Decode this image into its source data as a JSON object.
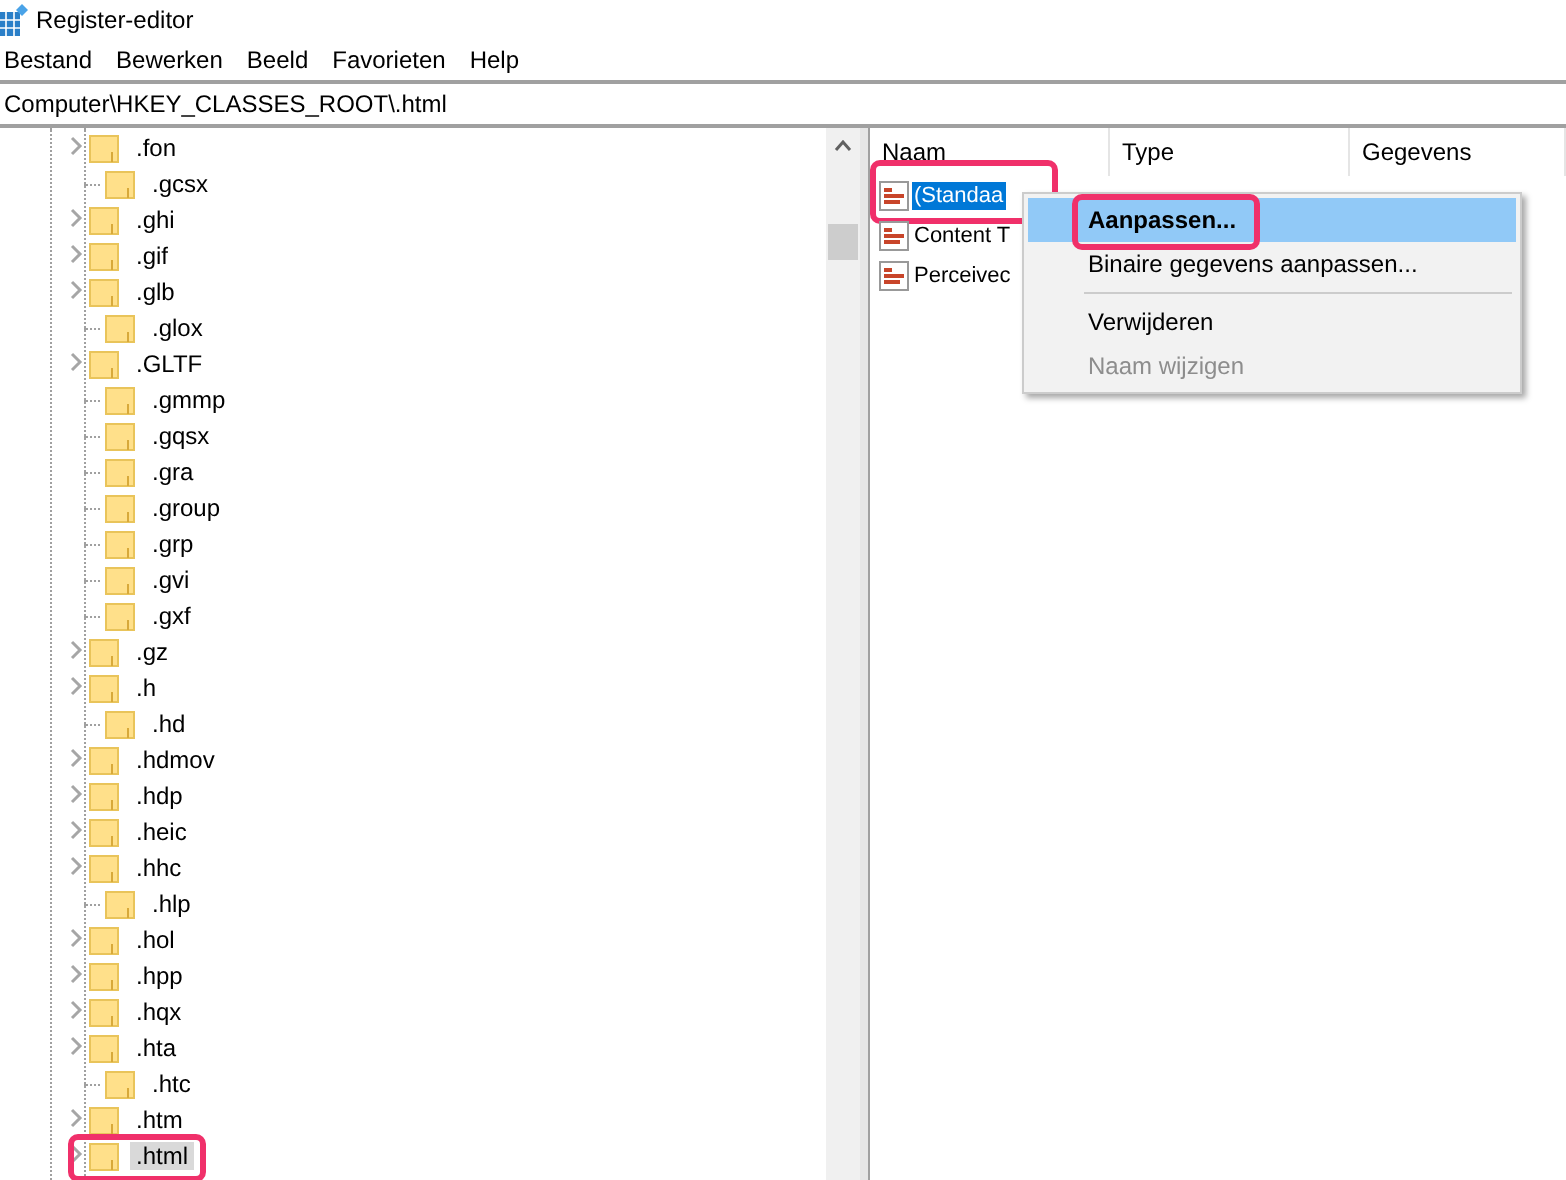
{
  "window": {
    "title": "Register-editor"
  },
  "menu_bar": [
    "Bestand",
    "Bewerken",
    "Beeld",
    "Favorieten",
    "Help"
  ],
  "address": "Computer\\HKEY_CLASSES_ROOT\\.html",
  "tree": [
    {
      "label": ".fon",
      "expandable": true,
      "selected": false,
      "annotated": false
    },
    {
      "label": ".gcsx",
      "expandable": false,
      "selected": false,
      "annotated": false
    },
    {
      "label": ".ghi",
      "expandable": true,
      "selected": false,
      "annotated": false
    },
    {
      "label": ".gif",
      "expandable": true,
      "selected": false,
      "annotated": false
    },
    {
      "label": ".glb",
      "expandable": true,
      "selected": false,
      "annotated": false
    },
    {
      "label": ".glox",
      "expandable": false,
      "selected": false,
      "annotated": false
    },
    {
      "label": ".GLTF",
      "expandable": true,
      "selected": false,
      "annotated": false
    },
    {
      "label": ".gmmp",
      "expandable": false,
      "selected": false,
      "annotated": false
    },
    {
      "label": ".gqsx",
      "expandable": false,
      "selected": false,
      "annotated": false
    },
    {
      "label": ".gra",
      "expandable": false,
      "selected": false,
      "annotated": false
    },
    {
      "label": ".group",
      "expandable": false,
      "selected": false,
      "annotated": false
    },
    {
      "label": ".grp",
      "expandable": false,
      "selected": false,
      "annotated": false
    },
    {
      "label": ".gvi",
      "expandable": false,
      "selected": false,
      "annotated": false
    },
    {
      "label": ".gxf",
      "expandable": false,
      "selected": false,
      "annotated": false
    },
    {
      "label": ".gz",
      "expandable": true,
      "selected": false,
      "annotated": false
    },
    {
      "label": ".h",
      "expandable": true,
      "selected": false,
      "annotated": false
    },
    {
      "label": ".hd",
      "expandable": false,
      "selected": false,
      "annotated": false
    },
    {
      "label": ".hdmov",
      "expandable": true,
      "selected": false,
      "annotated": false
    },
    {
      "label": ".hdp",
      "expandable": true,
      "selected": false,
      "annotated": false
    },
    {
      "label": ".heic",
      "expandable": true,
      "selected": false,
      "annotated": false
    },
    {
      "label": ".hhc",
      "expandable": true,
      "selected": false,
      "annotated": false
    },
    {
      "label": ".hlp",
      "expandable": false,
      "selected": false,
      "annotated": false
    },
    {
      "label": ".hol",
      "expandable": true,
      "selected": false,
      "annotated": false
    },
    {
      "label": ".hpp",
      "expandable": true,
      "selected": false,
      "annotated": false
    },
    {
      "label": ".hqx",
      "expandable": true,
      "selected": false,
      "annotated": false
    },
    {
      "label": ".hta",
      "expandable": true,
      "selected": false,
      "annotated": false
    },
    {
      "label": ".htc",
      "expandable": false,
      "selected": false,
      "annotated": false
    },
    {
      "label": ".htm",
      "expandable": true,
      "selected": false,
      "annotated": false
    },
    {
      "label": ".html",
      "expandable": true,
      "selected": true,
      "annotated": true
    }
  ],
  "values": {
    "columns": [
      "Naam",
      "Type",
      "Gegevens"
    ],
    "rows": [
      {
        "name": "(Standaa",
        "selected": true,
        "annotated": true
      },
      {
        "name": "Content T",
        "selected": false,
        "annotated": false
      },
      {
        "name": "Perceivec",
        "selected": false,
        "annotated": false
      }
    ]
  },
  "context_menu": [
    {
      "kind": "item",
      "label": "Aanpassen...",
      "selected": true,
      "disabled": false,
      "annotated": true
    },
    {
      "kind": "item",
      "label": "Binaire gegevens aanpassen...",
      "selected": false,
      "disabled": false,
      "annotated": false
    },
    {
      "kind": "separator"
    },
    {
      "kind": "item",
      "label": "Verwijderen",
      "selected": false,
      "disabled": false,
      "annotated": false
    },
    {
      "kind": "item",
      "label": "Naam wijzigen",
      "selected": false,
      "disabled": true,
      "annotated": false
    }
  ]
}
